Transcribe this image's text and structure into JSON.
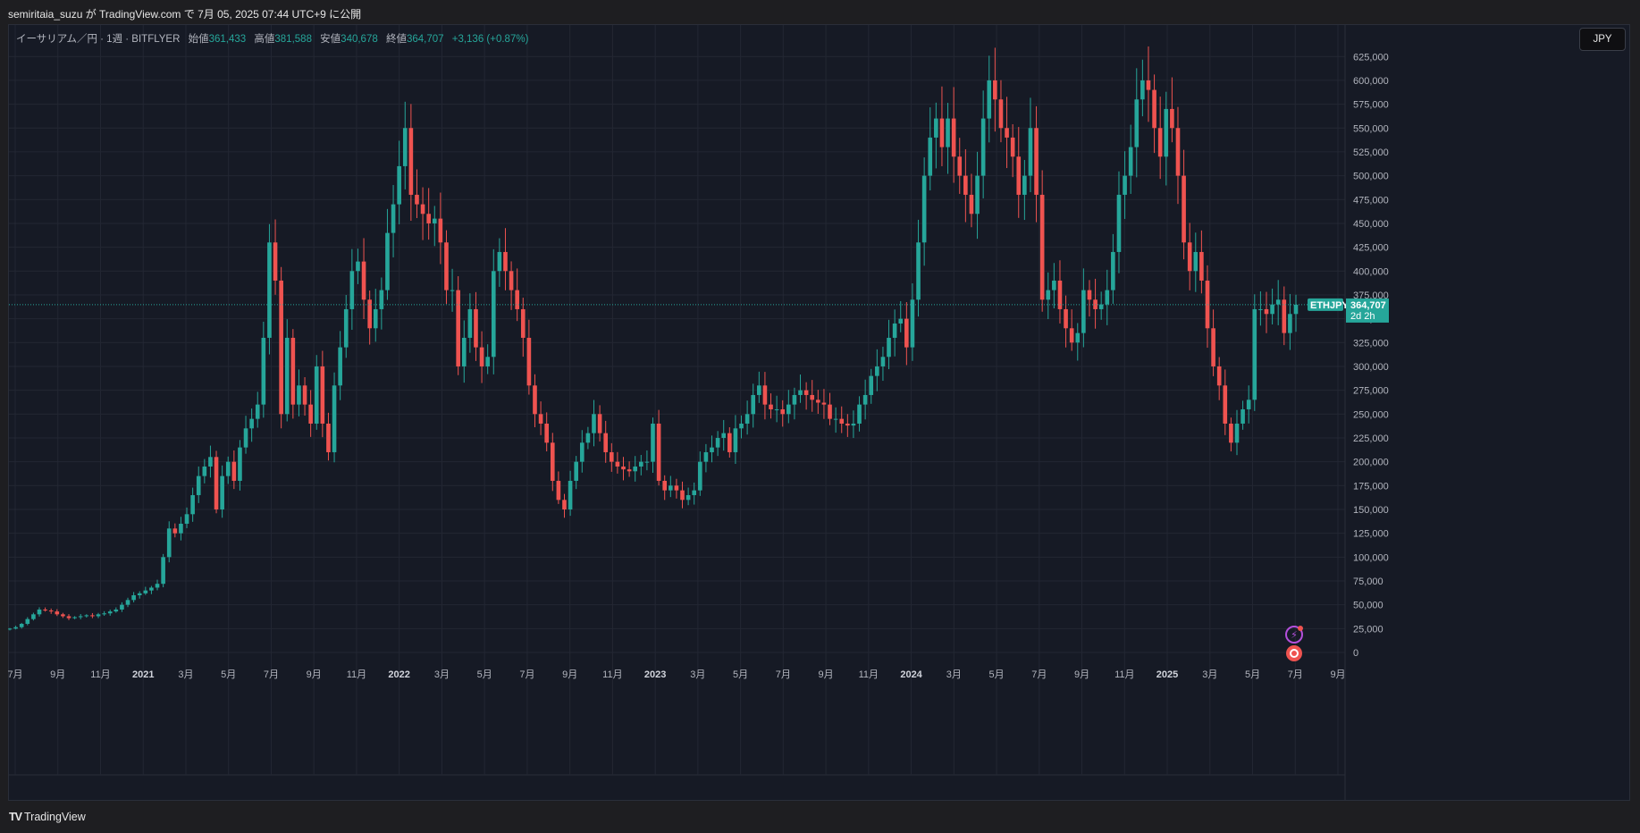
{
  "header": {
    "publish_text": "semiritaia_suzu が TradingView.com で 7月 05, 2025 07:44 UTC+9 に公開"
  },
  "legend": {
    "symbol": "イーサリアム／円 · 1週 · BITFLYER",
    "open_label": "始値",
    "open_value": "361,433",
    "high_label": "高値",
    "high_value": "381,588",
    "low_label": "安値",
    "low_value": "340,678",
    "close_label": "終値",
    "close_value": "364,707",
    "change": "+3,136 (+0.87%)"
  },
  "currency_button": "JPY",
  "price_tag": {
    "symbol": "ETHJPY",
    "price": "364,707",
    "countdown": "2d 2h"
  },
  "footer": {
    "brand": "TradingView"
  },
  "colors": {
    "up": "#26a69a",
    "down": "#ef5350",
    "background": "#161a25",
    "grid": "#232733"
  },
  "icons": [
    "tv-logo-icon",
    "lightning-alert-icon",
    "record-icon"
  ],
  "chart_data": {
    "type": "candlestick",
    "title": "イーサリアム／円 · 1週 · BITFLYER",
    "xlabel": "",
    "ylabel": "",
    "ylim": [
      0,
      637500
    ],
    "grid": true,
    "last_price": 364707,
    "y_ticks": [
      0,
      25000,
      50000,
      75000,
      100000,
      125000,
      150000,
      175000,
      200000,
      225000,
      250000,
      275000,
      300000,
      325000,
      350000,
      375000,
      400000,
      425000,
      450000,
      475000,
      500000,
      525000,
      550000,
      575000,
      600000,
      625000
    ],
    "x_ticks": [
      "7月",
      "9月",
      "11月",
      "2021",
      "3月",
      "5月",
      "7月",
      "9月",
      "11月",
      "2022",
      "3月",
      "5月",
      "7月",
      "9月",
      "11月",
      "2023",
      "3月",
      "5月",
      "7月",
      "9月",
      "11月",
      "2024",
      "3月",
      "5月",
      "7月",
      "9月",
      "11月",
      "2025",
      "3月",
      "5月",
      "7月",
      "9月"
    ],
    "year_ticks": [
      "2021",
      "2022",
      "2023",
      "2024",
      "2025"
    ],
    "closes": [
      25000,
      26500,
      30000,
      35000,
      40000,
      45000,
      44000,
      43000,
      40000,
      38000,
      36000,
      37000,
      38000,
      39000,
      38000,
      40000,
      41000,
      43000,
      45000,
      50000,
      55000,
      60000,
      62000,
      65000,
      68000,
      72000,
      100000,
      130000,
      125000,
      135000,
      145000,
      165000,
      185000,
      195000,
      205000,
      150000,
      185000,
      200000,
      180000,
      215000,
      235000,
      245000,
      260000,
      330000,
      430000,
      390000,
      250000,
      330000,
      260000,
      280000,
      260000,
      240000,
      300000,
      240000,
      210000,
      280000,
      320000,
      360000,
      400000,
      410000,
      370000,
      340000,
      360000,
      380000,
      440000,
      470000,
      510000,
      550000,
      480000,
      470000,
      460000,
      450000,
      455000,
      430000,
      380000,
      380000,
      300000,
      330000,
      360000,
      320000,
      300000,
      310000,
      400000,
      420000,
      400000,
      380000,
      360000,
      330000,
      280000,
      250000,
      240000,
      220000,
      180000,
      160000,
      150000,
      180000,
      200000,
      220000,
      230000,
      250000,
      230000,
      210000,
      200000,
      195000,
      192000,
      190000,
      195000,
      200000,
      200000,
      240000,
      180000,
      170000,
      175000,
      170000,
      160000,
      165000,
      170000,
      200000,
      210000,
      215000,
      225000,
      230000,
      210000,
      235000,
      240000,
      250000,
      270000,
      280000,
      260000,
      255000,
      255000,
      250000,
      260000,
      270000,
      275000,
      270000,
      265000,
      262000,
      260000,
      245000,
      245000,
      240000,
      238000,
      240000,
      260000,
      270000,
      290000,
      300000,
      310000,
      330000,
      345000,
      350000,
      320000,
      370000,
      430000,
      500000,
      540000,
      560000,
      530000,
      560000,
      520000,
      500000,
      480000,
      460000,
      500000,
      560000,
      600000,
      580000,
      550000,
      540000,
      520000,
      480000,
      500000,
      550000,
      480000,
      370000,
      380000,
      390000,
      360000,
      340000,
      325000,
      335000,
      380000,
      370000,
      360000,
      365000,
      380000,
      420000,
      480000,
      500000,
      530000,
      580000,
      600000,
      590000,
      550000,
      520000,
      570000,
      550000,
      500000,
      430000,
      400000,
      420000,
      390000,
      340000,
      300000,
      280000,
      240000,
      220000,
      240000,
      255000,
      265000,
      360000,
      360000,
      355000,
      365000,
      370000,
      335000,
      355000,
      364707
    ]
  }
}
